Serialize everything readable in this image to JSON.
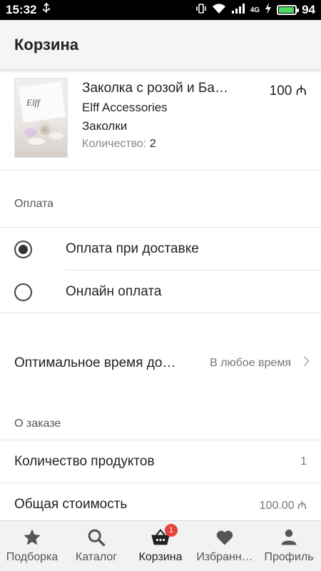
{
  "status_bar": {
    "time": "15:32",
    "network": "4G",
    "battery": "94",
    "battery_level": 0.94
  },
  "app_bar": {
    "title": "Корзина"
  },
  "product": {
    "name": "Заколка с розой и Ба…",
    "price": "100 ₼",
    "brand": "Elff Accessories",
    "category": "Заколки",
    "quantity_label": "Количество:",
    "quantity_value": "2",
    "thumb_text": "Elff"
  },
  "payment": {
    "header": "Оплата",
    "options": [
      {
        "label": "Оплата при доставке",
        "selected": true
      },
      {
        "label": "Онлайн оплата",
        "selected": false
      }
    ]
  },
  "delivery": {
    "label": "Оптимальное время до…",
    "value": "В любое время"
  },
  "order": {
    "header": "О заказе",
    "rows": [
      {
        "label": "Количество продуктов",
        "value": "1"
      },
      {
        "label": "Общая стоимость",
        "value": "100.00 ₼"
      }
    ]
  },
  "bottom_nav": {
    "items": [
      {
        "label": "Подборка",
        "icon": "star-icon",
        "active": false
      },
      {
        "label": "Каталог",
        "icon": "search-icon",
        "active": false
      },
      {
        "label": "Корзина",
        "icon": "basket-icon",
        "active": true,
        "badge": "1"
      },
      {
        "label": "Избранн…",
        "icon": "heart-icon",
        "active": false
      },
      {
        "label": "Профиль",
        "icon": "person-icon",
        "active": false
      }
    ]
  }
}
